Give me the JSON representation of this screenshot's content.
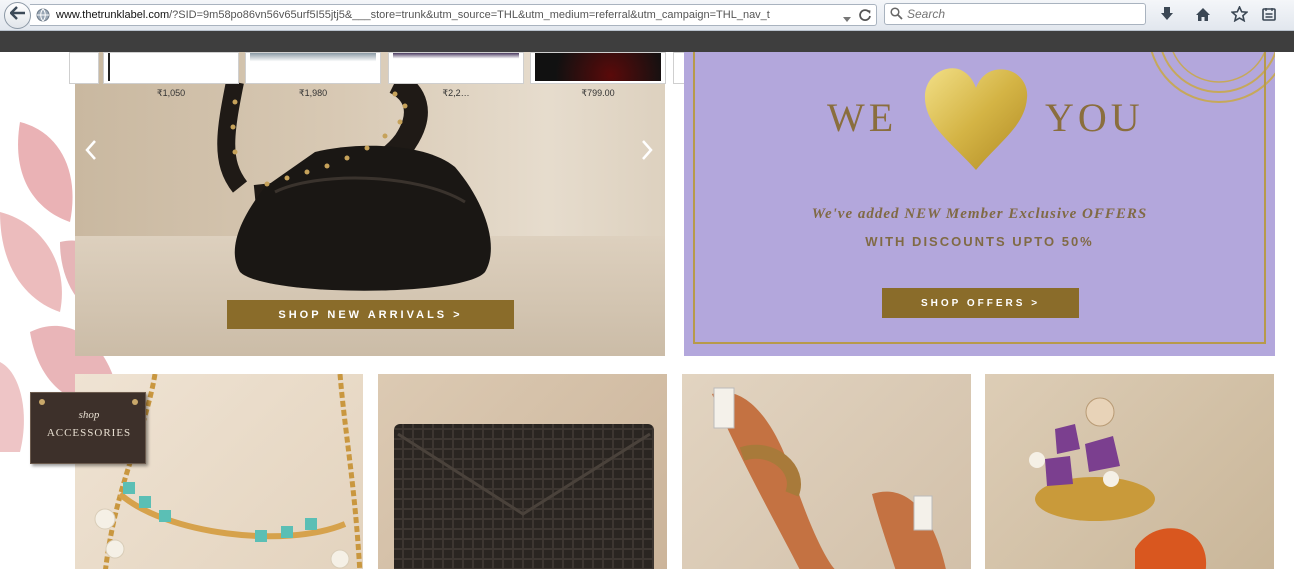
{
  "browser": {
    "url_host": "www.thetrunklabel.com",
    "url_rest": "/?SID=9m58po86vn56v65urf5I55jtj5&___store=trunk&utm_source=THL&utm_medium=referral&utm_campaign=THL_nav_t",
    "search_placeholder": "Search",
    "icons": [
      "back-icon",
      "globe-icon",
      "dropdown-icon",
      "reload-icon",
      "search-icon",
      "download-icon",
      "home-icon",
      "star-icon",
      "reading-list-icon"
    ]
  },
  "carousel": {
    "prices": [
      "₹1,050",
      "₹1,980",
      "₹2,2…",
      "₹799.00"
    ],
    "cta_label": "SHOP NEW ARRIVALS >",
    "prev_icon": "chevron-left-icon",
    "next_icon": "chevron-right-icon"
  },
  "promo": {
    "word_left": "WE",
    "word_right": "YOU",
    "line1": "We've added NEW Member Exclusive OFFERS",
    "line2": "WITH DISCOUNTS UPTO 50%",
    "cta_label": "SHOP OFFERS >"
  },
  "shop_tag": {
    "line1": "shop",
    "line2": "ACCESSORIES"
  },
  "colors": {
    "cta_bg": "#8a6c2a",
    "promo_bg": "#b3a7dc",
    "gold": "#b79a4a",
    "dark_strip": "#3e3e3e"
  }
}
